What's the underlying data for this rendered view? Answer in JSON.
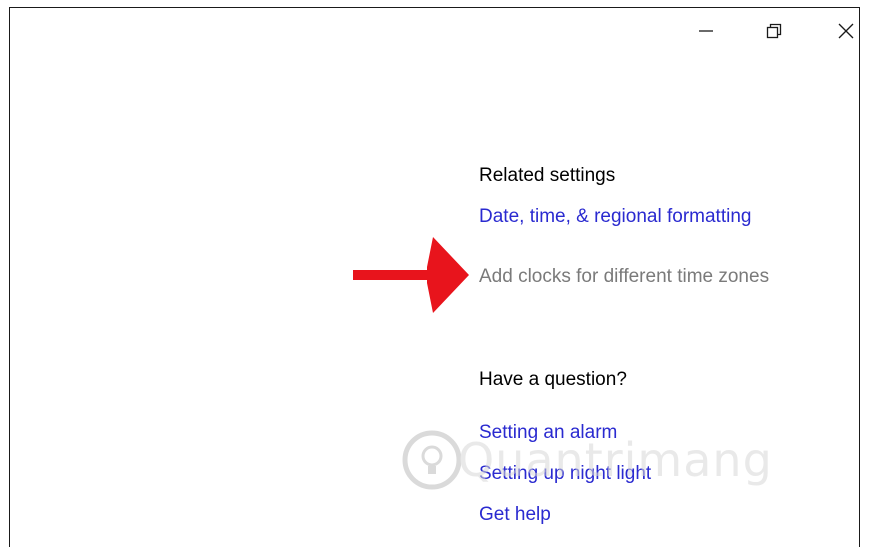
{
  "window": {
    "controls": {
      "minimize_icon": "minimize-icon",
      "restore_icon": "restore-icon",
      "close_icon": "close-icon"
    }
  },
  "related_settings": {
    "title": "Related settings",
    "links": [
      {
        "label": "Date, time, & regional formatting",
        "enabled": true
      },
      {
        "label": "Add clocks for different time zones",
        "enabled": false
      }
    ]
  },
  "help": {
    "title": "Have a question?",
    "links": [
      {
        "label": "Setting an alarm"
      },
      {
        "label": "Setting up night light"
      },
      {
        "label": "Get help"
      }
    ]
  },
  "annotation": {
    "arrow_color": "#e8141c",
    "arrow_icon": "red-arrow-icon"
  },
  "watermark": {
    "text": "Quantrimang"
  },
  "colors": {
    "link": "#2a2ad0",
    "disabled": "#7a7a7a",
    "text": "#000000",
    "arrow": "#e8141c"
  }
}
